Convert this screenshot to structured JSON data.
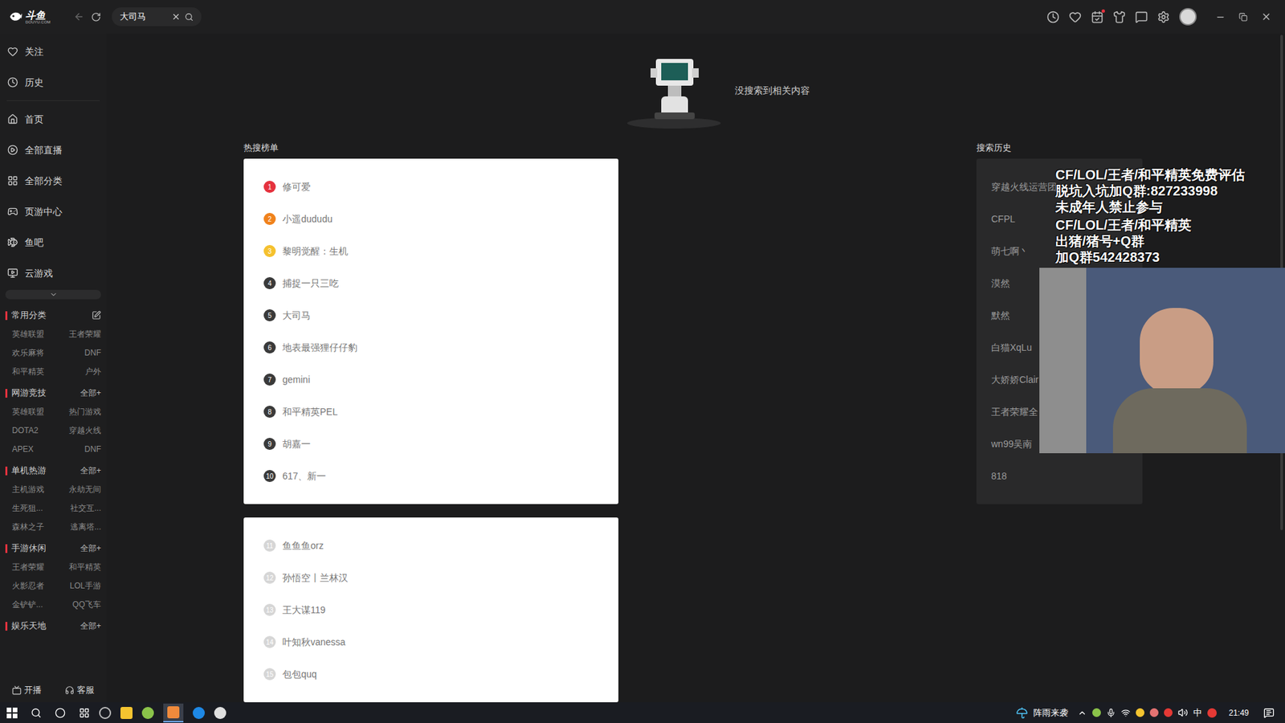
{
  "app": {
    "logo": "斗鱼",
    "logo_sub": "DOUYU.COM"
  },
  "search": {
    "value": "大司马"
  },
  "sidebar": {
    "nav": [
      "关注",
      "历史",
      "首页",
      "全部直播",
      "全部分类",
      "页游中心",
      "鱼吧",
      "云游戏"
    ],
    "sections": [
      {
        "title": "常用分类",
        "kind": "editable",
        "action": "",
        "items": [
          "英雄联盟",
          "王者荣耀",
          "欢乐麻将",
          "DNF",
          "和平精英",
          "户外"
        ]
      },
      {
        "title": "网游竞技",
        "kind": "more",
        "action": "全部+",
        "items": [
          "英雄联盟",
          "热门游戏",
          "DOTA2",
          "穿越火线",
          "APEX",
          "DNF"
        ]
      },
      {
        "title": "单机热游",
        "kind": "more",
        "action": "全部+",
        "items": [
          "主机游戏",
          "永劫无间",
          "生死狙...",
          "社交互...",
          "森林之子",
          "逃离塔..."
        ]
      },
      {
        "title": "手游休闲",
        "kind": "more",
        "action": "全部+",
        "items": [
          "王者荣耀",
          "和平精英",
          "火影忍者",
          "LOL手游",
          "金铲铲...",
          "QQ飞车"
        ]
      },
      {
        "title": "娱乐天地",
        "kind": "more",
        "action": "全部+",
        "items": []
      }
    ],
    "footer": [
      "开播",
      "客服"
    ]
  },
  "empty_state": {
    "message": "没搜索到相关内容"
  },
  "hot_search": {
    "title": "热搜榜单",
    "groups": [
      [
        {
          "rank": "1",
          "label": "修可爱",
          "color": "#e5323e"
        },
        {
          "rank": "2",
          "label": "小遥dududu",
          "color": "#f0821c"
        },
        {
          "rank": "3",
          "label": "黎明觉醒：生机",
          "color": "#f5c12e"
        },
        {
          "rank": "4",
          "label": "捕捉一只三吃",
          "color": "#3a3a3a"
        },
        {
          "rank": "5",
          "label": "大司马",
          "color": "#3a3a3a"
        },
        {
          "rank": "6",
          "label": "地表最强狸仔仔豹",
          "color": "#3a3a3a"
        },
        {
          "rank": "7",
          "label": "gemini",
          "color": "#3a3a3a"
        },
        {
          "rank": "8",
          "label": "和平精英PEL",
          "color": "#3a3a3a"
        },
        {
          "rank": "9",
          "label": "胡嘉一",
          "color": "#3a3a3a"
        },
        {
          "rank": "10",
          "label": "617、新一",
          "color": "#3a3a3a"
        }
      ],
      [
        {
          "rank": "11",
          "label": "鱼鱼鱼orz",
          "color": "#d6d6d6"
        },
        {
          "rank": "12",
          "label": "孙悟空丨兰林汉",
          "color": "#d6d6d6"
        },
        {
          "rank": "13",
          "label": "王大谋119",
          "color": "#d6d6d6"
        },
        {
          "rank": "14",
          "label": "叶知秋vanessa",
          "color": "#d6d6d6"
        },
        {
          "rank": "15",
          "label": "包包quq",
          "color": "#d6d6d6"
        }
      ]
    ]
  },
  "search_history": {
    "title": "搜索历史",
    "items": [
      "穿越火线运营团",
      "CFPL",
      "萌七啊丶",
      "漠然",
      "默然",
      "白猫XqLu",
      "大娇娇Clair",
      "王者荣耀全",
      "wn99吴南",
      "818"
    ]
  },
  "stream_overlay": {
    "lines": [
      "CF/LOL/王者/和平精英免费评估",
      "脱坑入坑加Q群:827233998",
      "未成年人禁止参与",
      "CF/LOL/王者/和平精英",
      "出猪/猪号+Q群",
      "加Q群542428373"
    ]
  },
  "taskbar": {
    "weather": "阵雨来袭",
    "ime": "中",
    "time": "21:49"
  }
}
